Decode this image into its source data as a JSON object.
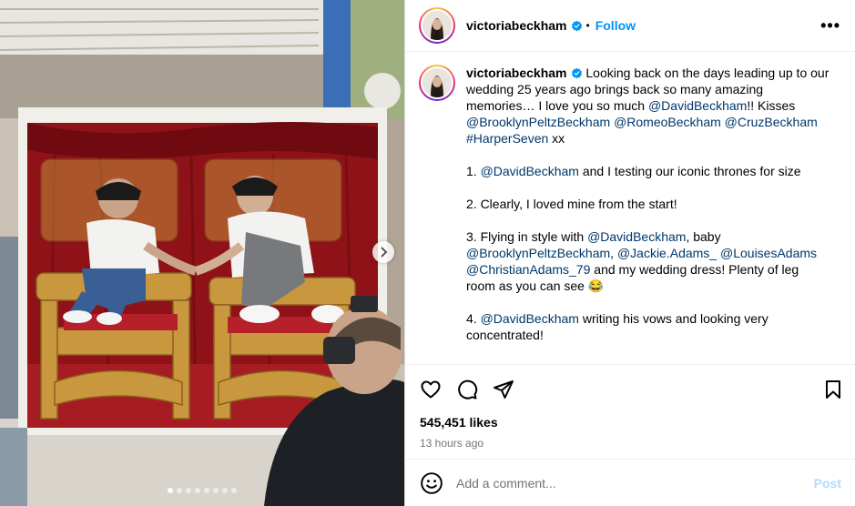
{
  "post": {
    "username": "victoriabeckham",
    "separator": "•",
    "follow_label": "Follow",
    "more_label": "•••",
    "caption": {
      "username": "victoriabeckham",
      "p1_a": " Looking back on the days leading up to our wedding 25 years ago brings back so many amazing memories… I love you so much ",
      "p1_mention1": "@DavidBeckham",
      "p1_b": "!! Kisses ",
      "p1_mention2": "@BrooklynPeltzBeckham",
      "p1_mention3": "@RomeoBeckham",
      "p1_mention4": "@CruzBeckham",
      "p1_hashtag": "#HarperSeven",
      "p1_c": " xx",
      "p2_a": "1. ",
      "p2_mention": "@DavidBeckham",
      "p2_b": " and I testing our iconic thrones for size",
      "p3": "2. Clearly, I loved mine from the start!",
      "p4_a": "3. Flying in style with ",
      "p4_mention1": "@DavidBeckham",
      "p4_b": ", baby ",
      "p4_mention2": "@BrooklynPeltzBeckham",
      "p4_mention3": "@Jackie.Adams_",
      "p4_mention4": "@LouisesAdams",
      "p4_mention5": "@ChristianAdams_79",
      "p4_c": " and my wedding dress! Plenty of leg room as you can see 😂",
      "p5_a": "4. ",
      "p5_mention": "@DavidBeckham",
      "p5_b": " writing his vows and looking very concentrated!"
    },
    "likes": "545,451 likes",
    "time": "13 hours ago",
    "comment_placeholder": "Add a comment...",
    "post_label": "Post",
    "carousel": {
      "count": 8,
      "active_index": 0
    }
  },
  "icons": {
    "like": "heart-icon",
    "comment": "comment-icon",
    "share": "share-icon",
    "save": "bookmark-icon",
    "emoji": "emoji-icon",
    "verified": "verified-badge-icon",
    "next": "chevron-right-icon"
  },
  "colors": {
    "link": "#00376b",
    "follow": "#0095f6",
    "verified": "#0095f6",
    "post_disabled": "#b3dbff"
  }
}
